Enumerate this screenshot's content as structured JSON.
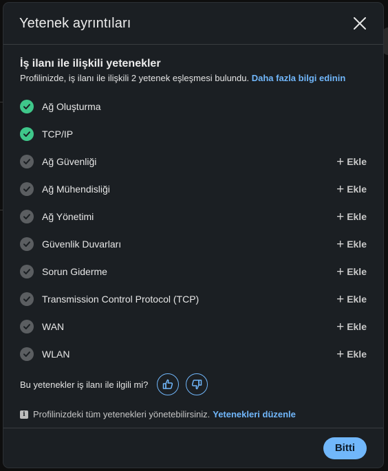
{
  "modal": {
    "title": "Yetenek ayrıntıları",
    "section_title": "İş ilanı ile ilişkili yetenekler",
    "subtitle_text": "Profilinizde, iş ilanı ile ilişkili 2 yetenek eşleşmesi bulundu.",
    "learn_more_link": "Daha fazla bilgi edinin",
    "add_label": "Ekle",
    "skills": [
      {
        "name": "Ağ Oluşturma",
        "matched": true
      },
      {
        "name": "TCP/IP",
        "matched": true
      },
      {
        "name": "Ağ Güvenliği",
        "matched": false
      },
      {
        "name": "Ağ Mühendisliği",
        "matched": false
      },
      {
        "name": "Ağ Yönetimi",
        "matched": false
      },
      {
        "name": "Güvenlik Duvarları",
        "matched": false
      },
      {
        "name": "Sorun Giderme",
        "matched": false
      },
      {
        "name": "Transmission Control Protocol (TCP)",
        "matched": false
      },
      {
        "name": "WAN",
        "matched": false
      },
      {
        "name": "WLAN",
        "matched": false
      }
    ],
    "feedback_question": "Bu yetenekler iş ilanı ile ilgili mi?",
    "info_text": "Profilinizdeki tüm yetenekleri yönetebilirsiniz.",
    "edit_skills_link": "Yetenekleri düzenle",
    "done_label": "Bitti"
  },
  "colors": {
    "accent": "#71b7fb",
    "matched": "#3fc78a",
    "unmatched": "#5b5e61",
    "modal_bg": "#1b1f23"
  }
}
